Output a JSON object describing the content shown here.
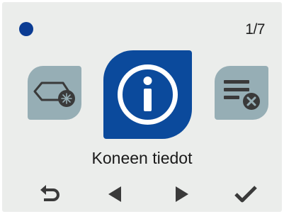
{
  "header": {
    "status_dot_color": "#0b3c93",
    "page_indicator": "1/7"
  },
  "carousel": {
    "left_icon": "filter-maintenance-icon",
    "center_icon": "info-icon",
    "right_icon": "clear-alarms-icon",
    "selected_label": "Koneen tiedot",
    "selected_color": "#0b4a9c",
    "side_color": "#96aeb5"
  },
  "nav": {
    "buttons": [
      "back-icon",
      "previous-icon",
      "next-icon",
      "confirm-icon"
    ]
  }
}
